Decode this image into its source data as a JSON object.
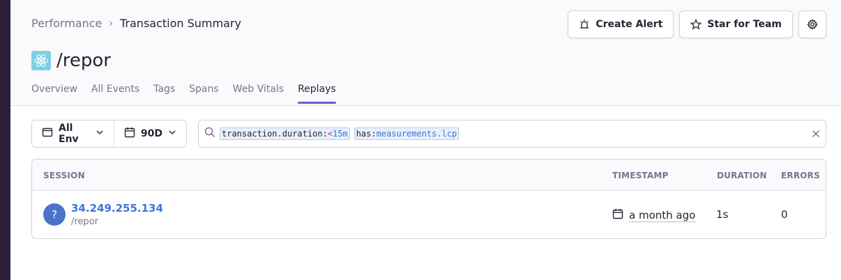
{
  "breadcrumb": {
    "parent": "Performance",
    "separator": "›",
    "current": "Transaction Summary"
  },
  "title": {
    "icon": "react-atom-icon",
    "text": "/repor"
  },
  "tabs": [
    {
      "label": "Overview"
    },
    {
      "label": "All Events"
    },
    {
      "label": "Tags"
    },
    {
      "label": "Spans"
    },
    {
      "label": "Web Vitals"
    },
    {
      "label": "Replays",
      "active": true
    }
  ],
  "actions": {
    "create_alert": "Create Alert",
    "star_for_team": "Star for Team",
    "settings_icon": "gear-icon"
  },
  "filters": {
    "environment": "All Env",
    "period": "90D"
  },
  "search": {
    "tokens": [
      {
        "key": "transaction.duration",
        "sep": ":",
        "op": "<",
        "value": "15m"
      },
      {
        "key": "has",
        "sep": ":",
        "op": "",
        "value": "measurements.lcp"
      }
    ]
  },
  "table": {
    "headers": {
      "session": "SESSION",
      "timestamp": "TIMESTAMP",
      "duration": "DURATION",
      "errors": "ERRORS"
    },
    "rows": [
      {
        "avatar": "?",
        "session": "34.249.255.134",
        "path": "/repor",
        "timestamp": "a month ago",
        "duration": "1s",
        "errors": "0"
      }
    ]
  },
  "colors": {
    "accent": "#6c5fc7",
    "link": "#3d74db",
    "avatar": "#4a74c9",
    "sidebar": "#2c1f3a"
  }
}
